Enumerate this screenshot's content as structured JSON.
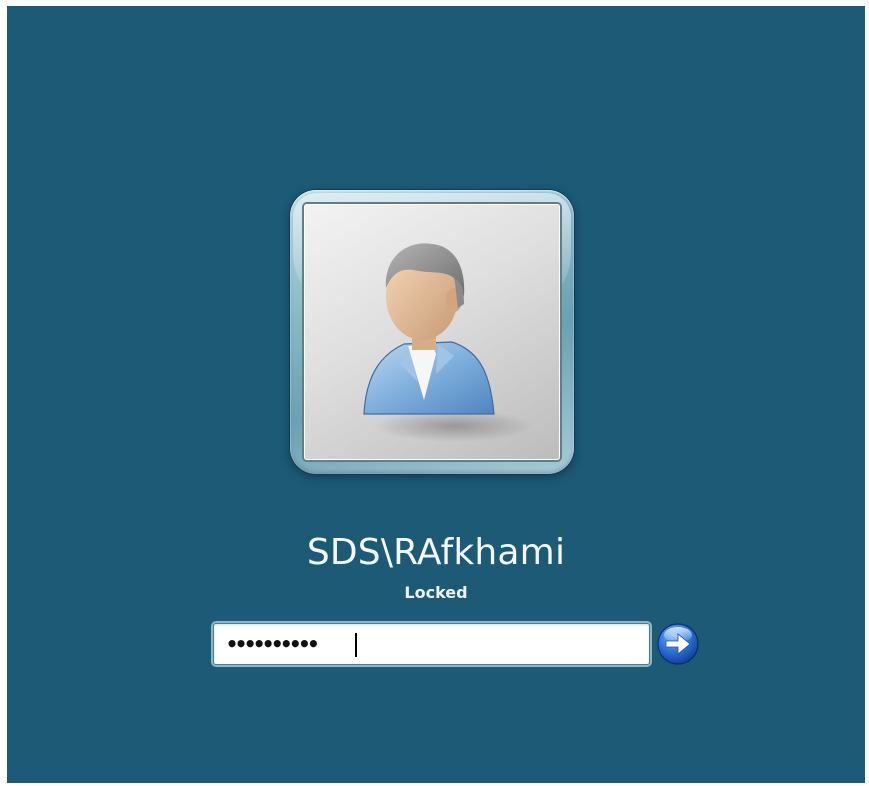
{
  "user": {
    "name": "SDS\\RAfkhami",
    "status": "Locked"
  },
  "password_field": {
    "masked_value": "••••••••••"
  },
  "submit": {
    "icon": "arrow-right-icon"
  },
  "colors": {
    "background": "#1c5a76",
    "text": "#f4f8fa",
    "button": "#2b6fd6"
  }
}
